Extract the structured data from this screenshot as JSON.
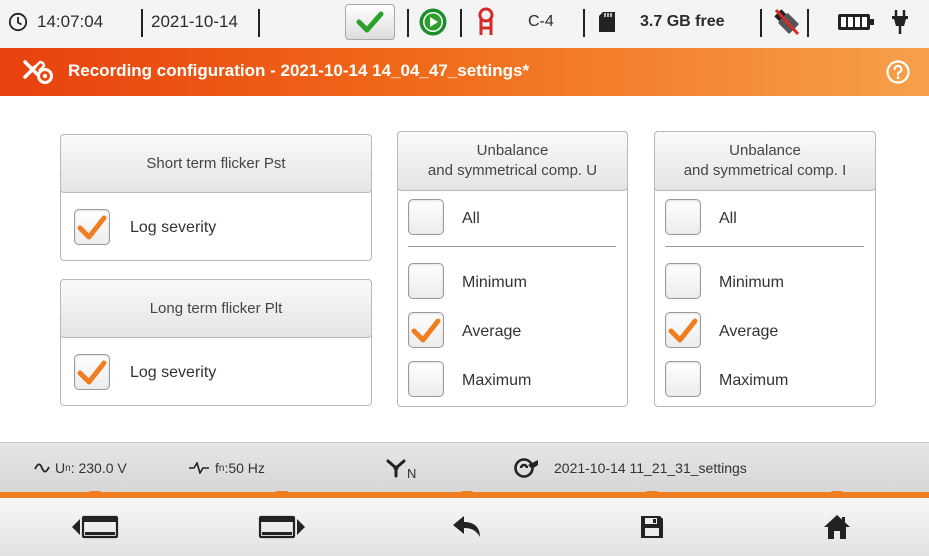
{
  "status_bar": {
    "time": "14:07:04",
    "date": "2021-10-14",
    "config": "C-4",
    "storage": "3.7 GB free"
  },
  "title_bar": {
    "title": "Recording configuration - 2021-10-14 14_04_47_settings*"
  },
  "panels": {
    "pst": {
      "header": "Short term flicker Pst",
      "log_severity": {
        "label": "Log severity",
        "checked": true
      }
    },
    "plt": {
      "header": "Long term flicker Plt",
      "log_severity": {
        "label": "Log severity",
        "checked": true
      }
    },
    "unbalance_u": {
      "header_line1": "Unbalance",
      "header_line2": "and symmetrical comp. U",
      "all": {
        "label": "All",
        "checked": false
      },
      "minimum": {
        "label": "Minimum",
        "checked": false
      },
      "average": {
        "label": "Average",
        "checked": true
      },
      "maximum": {
        "label": "Maximum",
        "checked": false
      }
    },
    "unbalance_i": {
      "header_line1": "Unbalance",
      "header_line2": "and symmetrical comp. I",
      "all": {
        "label": "All",
        "checked": false
      },
      "minimum": {
        "label": "Minimum",
        "checked": false
      },
      "average": {
        "label": "Average",
        "checked": true
      },
      "maximum": {
        "label": "Maximum",
        "checked": false
      }
    }
  },
  "info_bar": {
    "un_symbol": "U",
    "un_sub": "n",
    "un_value": ": 230.0 V",
    "fn_symbol": "f",
    "fn_sub": "n",
    "fn_value": ":50 Hz",
    "network_sub": "N",
    "settings_file": "2021-10-14 11_21_31_settings"
  },
  "colors": {
    "accent": "#f07d20",
    "title_start": "#e8410e",
    "title_end": "#f7a04a",
    "check": "#f07d20"
  },
  "icons": [
    "clock-icon",
    "ok-check-icon",
    "play-icon",
    "probe-icon",
    "sd-card-icon",
    "usb-off-icon",
    "battery-icon",
    "plug-icon",
    "settings-icon",
    "help-icon",
    "sine-icon",
    "frequency-icon",
    "network-icon",
    "wrench-icon",
    "prev-screen-icon",
    "next-screen-icon",
    "back-icon",
    "save-icon",
    "home-icon"
  ]
}
